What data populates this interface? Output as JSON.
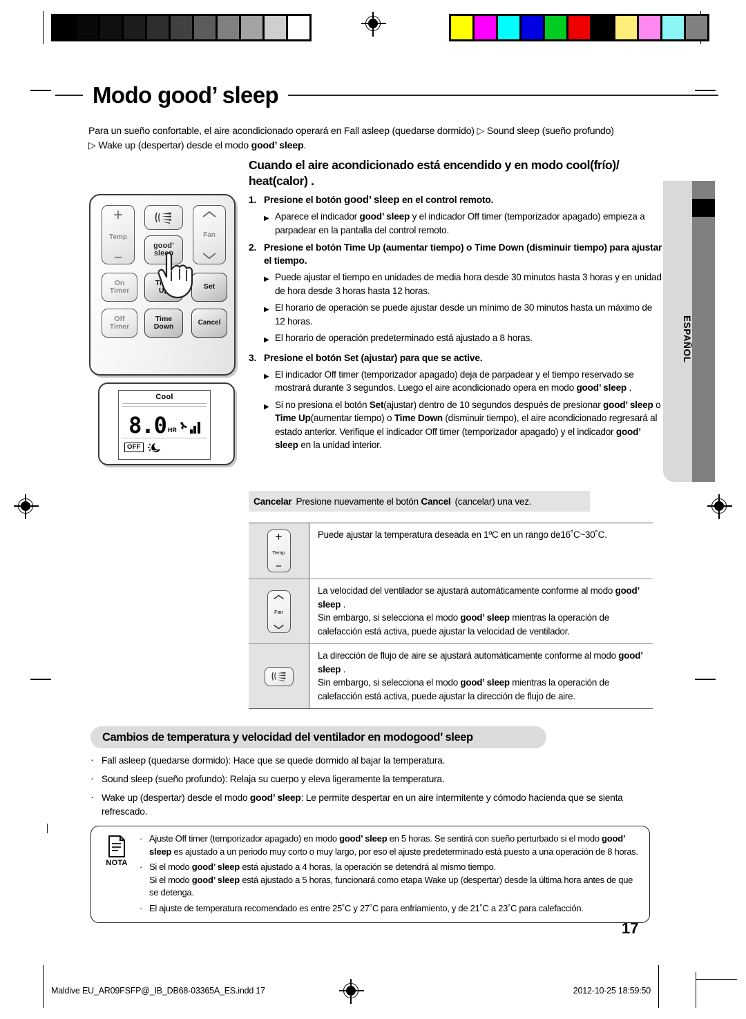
{
  "document": {
    "title": "Modo good’ sleep",
    "title_plain": "Modo ",
    "title_brand": "good’ sleep",
    "page_number": "17",
    "side_tab_label": "ESPAÑOL"
  },
  "intro": {
    "line1": "Para un sueño confortable, el aire acondicionado operará en Fall asleep (quedarse dormido) ▷ Sound sleep (sueño profundo)",
    "line2_pre": "▷ Wake up (despertar) desde el modo ",
    "line2_brand": "good’ sleep",
    "line2_post": "."
  },
  "remote": {
    "caption": "remote-control-diagram",
    "buttons": {
      "temp_plus": "+",
      "temp_label": "Temp",
      "temp_minus": "−",
      "fan_label": "Fan",
      "good_sleep_line1": "good’",
      "good_sleep_line2": "sleep",
      "on_timer_line1": "On",
      "on_timer_line2": "Timer",
      "time_up_line1": "Time",
      "time_up_line2": "Up",
      "set": "Set",
      "off_timer_line1": "Off",
      "off_timer_line2": "Timer",
      "time_down_line1": "Time",
      "time_down_line2": "Down",
      "cancel": "Cancel"
    }
  },
  "lcd": {
    "mode": "Cool",
    "time_value": "8.0",
    "unit": "HR",
    "off_badge": "OFF"
  },
  "instructions": {
    "heading_line1": "Cuando el aire acondicionado está encendido y en modo cool(frío)/",
    "heading_line2": "heat(calor) .",
    "step1": {
      "num": "1.",
      "pre": "Presione el botón ",
      "brand": "good’ sleep",
      "post": " en el control remoto.",
      "bullets": [
        {
          "pre": "Aparece el indicador ",
          "brand": "good’ sleep",
          "post": " y el indicador Off timer (temporizador apagado) empieza a parpadear en la pantalla del control remoto."
        }
      ]
    },
    "step2": {
      "num": "2.",
      "text": "Presione el botón Time Up (aumentar tiempo) o Time Down (disminuir tiempo) para ajustar el tiempo.",
      "bullets": [
        "Puede ajustar el tiempo en unidades de media hora desde 30 minutos hasta 3 horas y en unidad de hora desde 3 horas hasta 12 horas.",
        "El horario de operación se puede ajustar desde un mínimo de 30 minutos hasta un máximo de 12 horas.",
        "El horario de operación predeterminado está ajustado a 8 horas."
      ]
    },
    "step3": {
      "num": "3.",
      "text": "Presione el botón Set (ajustar) para que se active.",
      "bullet1": {
        "pre": "El indicador Off timer (temporizador apagado) deja de parpadear y el tiempo reservado se mostrará durante 3 segundos. Luego el aire acondicionado opera en modo ",
        "brand": "good’ sleep",
        "post": " ."
      },
      "bullet2": {
        "p1": "Si no presiona el botón ",
        "b1": "Set",
        "p2": "(ajustar) dentro de 10 segundos después de presionar ",
        "b2": "good’ sleep",
        "p3": " o ",
        "b3": "Time Up",
        "p4": "(aumentar tiempo) o ",
        "b4": "Time Down",
        "p5": " (disminuir tiempo), el aire acondicionado regresará al estado anterior.  Verifique el indicador Off timer (temporizador apagado) y el indicador ",
        "b5": "good’ sleep",
        "p6": " en la unidad interior."
      }
    }
  },
  "cancel_bar": {
    "label": "Cancelar",
    "pre": "Presione nuevamente el botón ",
    "bold": "Cancel",
    "post": "(cancelar) una vez."
  },
  "feature_table": {
    "rows": [
      {
        "icon": "temp-button-icon",
        "icon_labels": {
          "plus": "+",
          "name": "Temp",
          "minus": "−"
        },
        "lines": [
          {
            "type": "plain",
            "text": "Puede ajustar la temperatura deseada en 1ºC en un rango de16˚C~30˚C."
          }
        ]
      },
      {
        "icon": "fan-button-icon",
        "icon_labels": {
          "name": "Fan"
        },
        "lines": [
          {
            "type": "brand",
            "pre": "La velocidad del ventilador se ajustará automáticamente conforme al modo ",
            "brand": "good’ sleep",
            "post": " ."
          },
          {
            "type": "brand",
            "pre": "Sin embargo, si selecciona el modo ",
            "brand": "good’ sleep",
            "post": " mientras la operación de calefacción está activa, puede ajustar la velocidad de ventilador."
          }
        ]
      },
      {
        "icon": "air-swing-button-icon",
        "icon_labels": {},
        "lines": [
          {
            "type": "brand",
            "pre": "La dirección de flujo de aire se ajustará automáticamente conforme al modo ",
            "brand": "good’ sleep",
            "post": " ."
          },
          {
            "type": "brand",
            "pre": "Sin embargo, si selecciona el modo ",
            "brand": "good’ sleep",
            "post": " mientras la operación de calefacción está activa, puede ajustar la dirección de flujo de aire."
          }
        ]
      }
    ]
  },
  "section2": {
    "heading_pre": "Cambios de temperatura y velocidad del ventilador en modo ",
    "heading_brand": "good’ sleep",
    "bullets": [
      {
        "text": "Fall asleep (quedarse dormido): Hace que se quede dormido al bajar la temperatura."
      },
      {
        "text": "Sound sleep (sueño profundo): Relaja su cuerpo y eleva ligeramente la temperatura."
      },
      {
        "pre": "Wake up (despertar) desde el modo ",
        "brand": "good’ sleep",
        "post": ": Le permite despertar en un aire intermitente y cómodo hacienda que se sienta refrescado."
      }
    ]
  },
  "nota": {
    "label": "NOTA",
    "bullets": [
      {
        "p1": "Ajuste Off timer (temporizador apagado) en modo ",
        "b1": "good’ sleep",
        "p2": " en 5 horas. Se sentirá con sueño perturbado si el modo ",
        "b2": "good’ sleep",
        "p3": " es ajustado a un periodo muy corto o muy largo, por eso el ajuste predeterminado está puesto a una operación de 8 horas."
      },
      {
        "p1": "Si el modo ",
        "b1": "good’ sleep",
        "p2": " está ajustado a 4 horas, la operación se detendrá al mismo tiempo.",
        "p3": "Si el modo ",
        "b2": "good’ sleep",
        "p4": " está ajustado a 5 horas, funcionará como etapa Wake up (despertar) desde la última hora antes de que se detenga."
      },
      {
        "plain": "El ajuste de temperatura recomendado es entre 25˚C y 27˚C para enfriamiento, y de 21˚C a 23˚C para calefacción."
      }
    ]
  },
  "footer": {
    "filename": "Maldive EU_AR09FSFP@_IB_DB68-03365A_ES.indd   17",
    "datetime": "2012-10-25   18:59:50"
  },
  "calibration": {
    "grayscale": [
      "#000000",
      "#080808",
      "#101010",
      "#1c1c1c",
      "#2e2e2e",
      "#414141",
      "#5c5c5c",
      "#808080",
      "#a3a3a3",
      "#cfcfcf",
      "#ffffff"
    ],
    "colors": [
      "#ffff00",
      "#ff00ff",
      "#00ffff",
      "#0000e0",
      "#00cc22",
      "#ee0000",
      "#000000",
      "#ffef7a",
      "#ff88f0",
      "#8cf5f5",
      "#808080"
    ]
  }
}
